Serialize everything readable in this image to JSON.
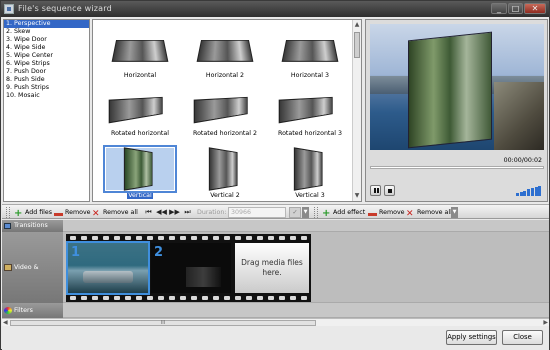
{
  "window": {
    "title": "File's sequence wizard",
    "controls": {
      "minimize": "_",
      "maximize": "□",
      "close": "✕"
    }
  },
  "effects": {
    "selected_index": 0,
    "items": [
      "1. Perspective",
      "2. Skew",
      "3. Wipe Door",
      "4. Wipe Side",
      "5. Wipe Center",
      "6. Wipe Strips",
      "7. Push Door",
      "8. Push Side",
      "9. Push Strips",
      "10. Mosaic"
    ]
  },
  "thumbnails": {
    "selected": "Vertical",
    "items": [
      "Horizontal",
      "Horizontal 2",
      "Horizontal 3",
      "Rotated horizontal",
      "Rotated horizontal 2",
      "Rotated horizontal 3",
      "Vertical",
      "Vertical 2",
      "Vertical 3"
    ]
  },
  "preview": {
    "time": "00:00/00:02",
    "progress": 0.0,
    "volume_bars": 7,
    "play_icon": "pause-icon",
    "stop_icon": "stop-icon"
  },
  "toolbar": {
    "add_files": "Add files",
    "remove": "Remove",
    "remove_all": "Remove all",
    "nav": [
      "⏮",
      "◀◀",
      "▶▶",
      "⏭"
    ],
    "duration_label": "Duration:",
    "duration_value": "30966",
    "add_effect": "Add effect",
    "remove_effect": "Remove",
    "remove_all_effects": "Remove all"
  },
  "timeline": {
    "tracks": [
      "Transitions",
      "Video & images",
      "Filters"
    ],
    "frames": [
      "1",
      "2"
    ],
    "dropzone_text": "Drag media files here.",
    "scroll_grip": "III"
  },
  "buttons": {
    "apply": "Apply settings",
    "close": "Close"
  },
  "colors": {
    "selection": "#3367c6",
    "accent_blue": "#2d6fd0",
    "add_green": "#2a9a2a",
    "remove_red": "#c83a2a"
  }
}
